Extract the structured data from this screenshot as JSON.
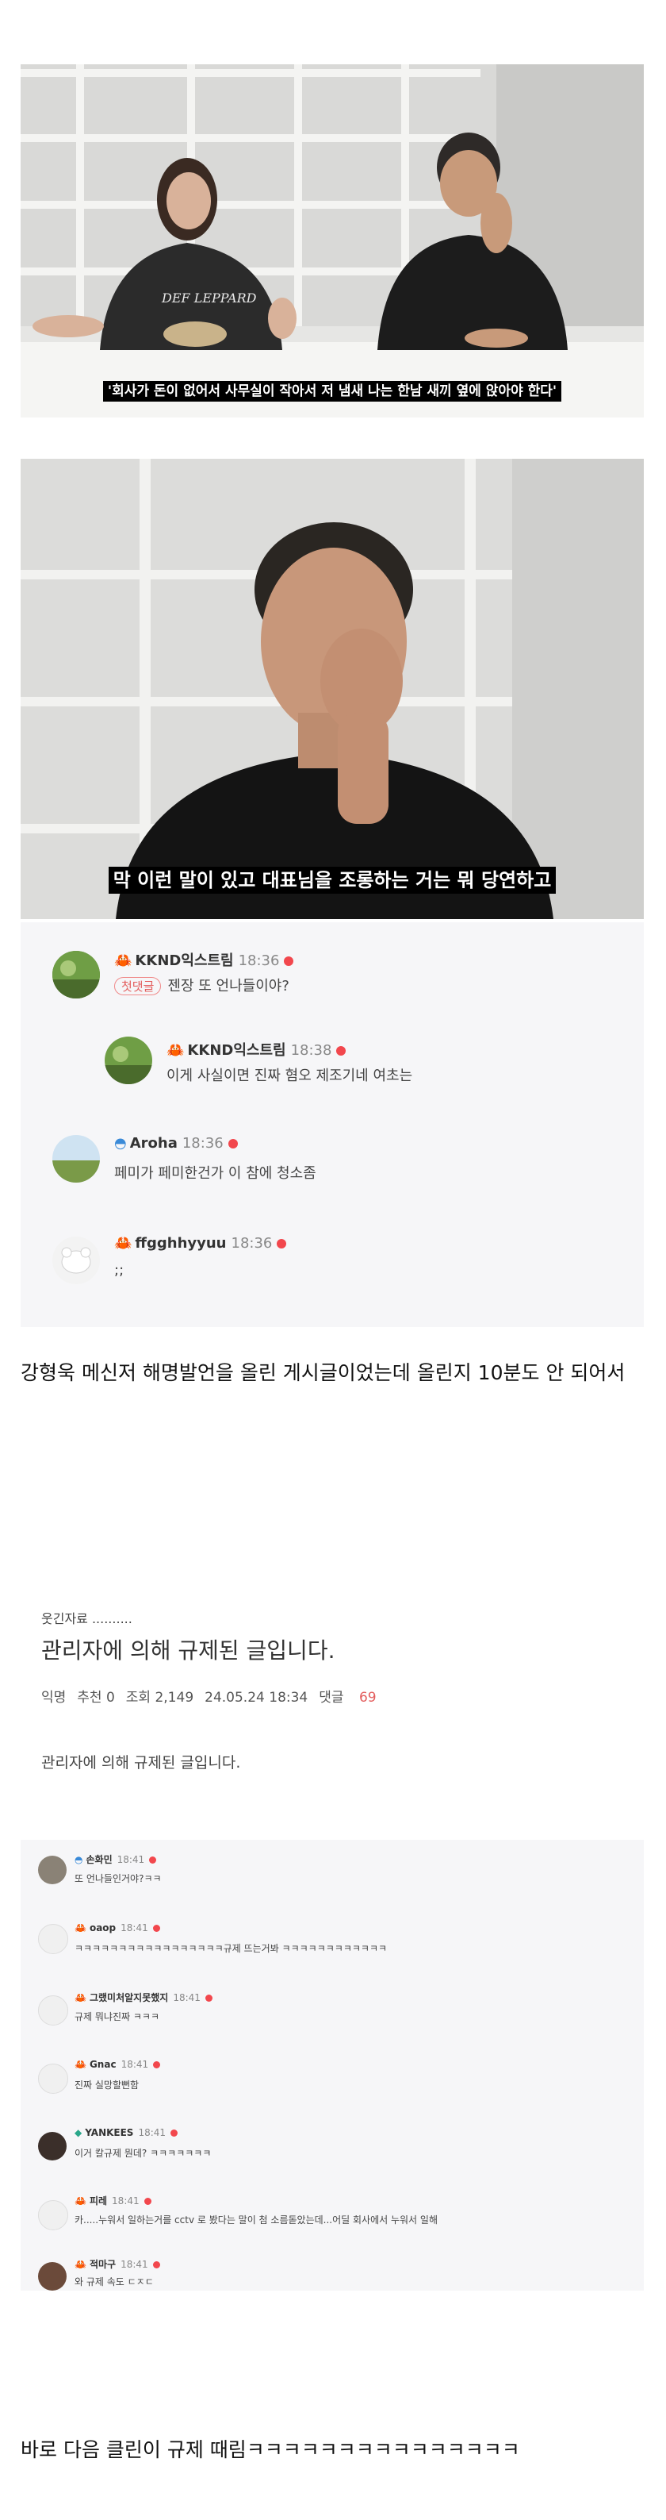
{
  "frame1": {
    "shirt_text": "DEF LEPPARD",
    "subtitle": "'회사가 돈이 없어서 사무실이 작아서 저 냄새 나는 한남 새끼 옆에 앉아야 한다'"
  },
  "frame2": {
    "subtitle": "막 이런 말이 있고 대표님을 조롱하는 거는 뭐 당연하고"
  },
  "comments1": [
    {
      "name": "KKND익스트림",
      "time": "18:36",
      "badge": "첫댓글",
      "text": "젠장 또 언나들이야?"
    },
    {
      "name": "KKND익스트림",
      "time": "18:38",
      "text": "이게 사실이면 진짜 혐오 제조기네 여초는"
    },
    {
      "name": "Aroha",
      "time": "18:36",
      "text": "페미가 페미한건가 이 참에 청소좀"
    },
    {
      "name": "ffgghhyyuu",
      "time": "18:36",
      "text": ";;"
    }
  ],
  "caption1": "강형욱 메신저 해명발언을 올린 게시글이었는데 올린지 10분도 안 되어서",
  "board": {
    "category": "웃긴자료 ..........",
    "title": "관리자에 의해 규제된 글입니다.",
    "meta": {
      "author": "익명",
      "recommend": "추천 0",
      "views": "조회 2,149",
      "date": "24.05.24 18:34",
      "reply_label": "댓글",
      "reply_count": "69"
    },
    "body": "관리자에 의해 규제된 글입니다."
  },
  "comments2": [
    {
      "name": "손화민",
      "time": "18:41",
      "text": "또 언나들인거야?ㅋㅋ"
    },
    {
      "name": "oaop",
      "time": "18:41",
      "text": "ㅋㅋㅋㅋㅋㅋㅋㅋㅋㅋㅋㅋㅋㅋㅋㅋㅋ규제 뜨는거봐 ㅋㅋㅋㅋㅋㅋㅋㅋㅋㅋㅋㅋ"
    },
    {
      "name": "그랬미처알지못했지",
      "time": "18:41",
      "text": "규제 뭐냐진짜 ㅋㅋㅋ"
    },
    {
      "name": "Gnac",
      "time": "18:41",
      "text": "진짜 실망할뻔함"
    },
    {
      "name": "YANKEES",
      "time": "18:41",
      "text": "이거 칼규제 뭔데? ㅋㅋㅋㅋㅋㅋㅋ"
    },
    {
      "name": "피레",
      "time": "18:41",
      "text": "카.....누워서 일하는거를 cctv 로 봤다는 말이 첨 소름돋았는데...어딜 회사에서 누워서 일해"
    },
    {
      "name": "적마구",
      "time": "18:41",
      "text": "와 규제 속도 ㄷㅈㄷ"
    }
  ],
  "caption2": "바로 다음 클린이 규제 때림ㅋㅋㅋㅋㅋㅋㅋㅋㅋㅋㅋㅋㅋㅋㅋ"
}
